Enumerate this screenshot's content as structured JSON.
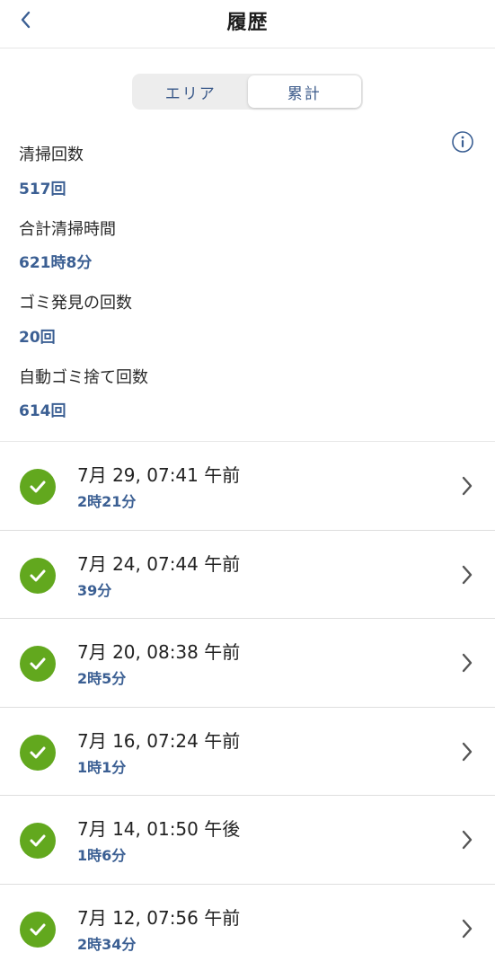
{
  "header": {
    "title": "履歴"
  },
  "segments": [
    {
      "label": "エリア",
      "active": false
    },
    {
      "label": "累計",
      "active": true
    }
  ],
  "stats": [
    {
      "label": "清掃回数",
      "value": "517回"
    },
    {
      "label": "合計清掃時間",
      "value": "621時8分"
    },
    {
      "label": "ゴミ発見の回数",
      "value": "20回"
    },
    {
      "label": "自動ゴミ捨て回数",
      "value": "614回"
    }
  ],
  "history": [
    {
      "date": "7月 29, 07:41 午前",
      "duration": "2時21分"
    },
    {
      "date": "7月 24, 07:44 午前",
      "duration": "39分"
    },
    {
      "date": "7月 20, 08:38 午前",
      "duration": "2時5分"
    },
    {
      "date": "7月 16, 07:24 午前",
      "duration": "1時1分"
    },
    {
      "date": "7月 14, 01:50 午後",
      "duration": "1時6分"
    },
    {
      "date": "7月 12, 07:56 午前",
      "duration": "2時34分"
    }
  ],
  "colors": {
    "accent": "#3b5f93",
    "success": "#62a81e",
    "divider": "#dedede"
  },
  "icons": {
    "back": "chevron-left-icon",
    "info": "info-circle-icon",
    "status": "check-circle-icon",
    "row": "chevron-right-icon"
  }
}
